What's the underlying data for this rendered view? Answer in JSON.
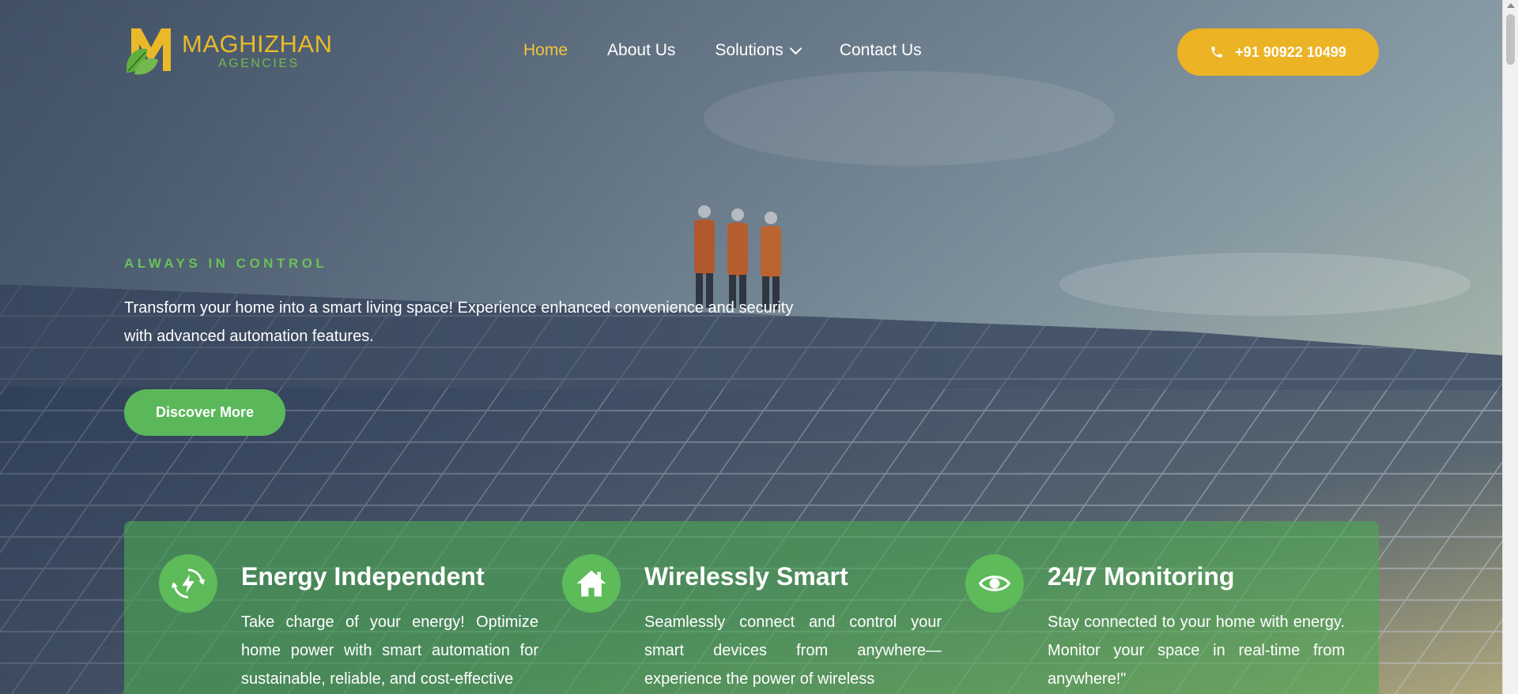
{
  "brand": {
    "name": "MAGHIZHAN",
    "subtitle": "AGENCIES",
    "colors": {
      "gold": "#ecb324",
      "green": "#5bb85a"
    }
  },
  "nav": {
    "items": [
      {
        "label": "Home",
        "active": true
      },
      {
        "label": "About Us",
        "active": false
      },
      {
        "label": "Solutions",
        "active": false,
        "has_dropdown": true
      },
      {
        "label": "Contact Us",
        "active": false
      }
    ]
  },
  "header": {
    "phone_label": "+91 90922 10499",
    "phone_icon": "phone-icon"
  },
  "hero": {
    "eyebrow": "ALWAYS IN CONTROL",
    "text": "Transform your home into a smart living space! Experience enhanced convenience and security with advanced automation features.",
    "cta_label": "Discover More"
  },
  "features": [
    {
      "icon": "energy-recycle-icon",
      "title": "Energy Independent",
      "desc": "Take charge of your energy! Optimize home power with smart automation for sustainable, reliable, and cost-effective"
    },
    {
      "icon": "home-icon",
      "title": "Wirelessly Smart",
      "desc": "Seamlessly connect and control your smart devices from anywhere—experience the power of wireless"
    },
    {
      "icon": "eye-icon",
      "title": "24/7 Monitoring",
      "desc": "Stay connected to your home with energy. Monitor your space in real-time from anywhere!\""
    }
  ]
}
